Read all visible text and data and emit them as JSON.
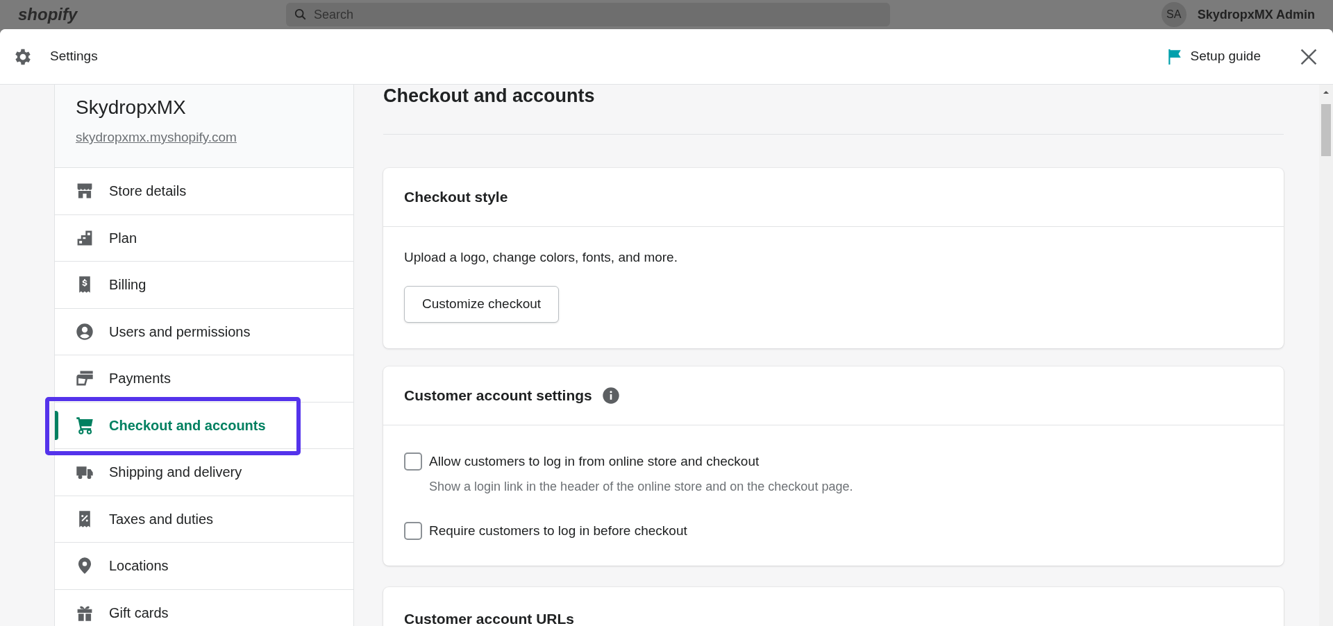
{
  "backdrop": {
    "logo": "shopify",
    "search_placeholder": "Search",
    "avatar": "SA",
    "account": "SkydropxMX Admin"
  },
  "window": {
    "title": "Settings",
    "setup_guide": "Setup guide"
  },
  "sidebar": {
    "store_name": "SkydropxMX",
    "store_url": "skydropxmx.myshopify.com",
    "items": [
      {
        "label": "Store details",
        "kind": "store",
        "selected": false,
        "highlighted": false
      },
      {
        "label": "Plan",
        "kind": "plan",
        "selected": false,
        "highlighted": false
      },
      {
        "label": "Billing",
        "kind": "billing",
        "selected": false,
        "highlighted": false
      },
      {
        "label": "Users and permissions",
        "kind": "user",
        "selected": false,
        "highlighted": false
      },
      {
        "label": "Payments",
        "kind": "payments",
        "selected": false,
        "highlighted": false
      },
      {
        "label": "Checkout and accounts",
        "kind": "cart",
        "selected": true,
        "highlighted": true
      },
      {
        "label": "Shipping and delivery",
        "kind": "truck",
        "selected": false,
        "highlighted": false
      },
      {
        "label": "Taxes and duties",
        "kind": "tax",
        "selected": false,
        "highlighted": false
      },
      {
        "label": "Locations",
        "kind": "pin",
        "selected": false,
        "highlighted": false
      },
      {
        "label": "Gift cards",
        "kind": "gift",
        "selected": false,
        "highlighted": false
      }
    ]
  },
  "page": {
    "title": "Checkout and accounts"
  },
  "checkout_style": {
    "title": "Checkout style",
    "description": "Upload a logo, change colors, fonts, and more.",
    "button": "Customize checkout"
  },
  "customer_account_settings": {
    "title": "Customer account settings",
    "options": [
      {
        "label": "Allow customers to log in from online store and checkout",
        "help": "Show a login link in the header of the online store and on the checkout page.",
        "checked": false
      },
      {
        "label": "Require customers to log in before checkout",
        "checked": false
      }
    ]
  },
  "customer_account_urls": {
    "title": "Customer account URLs"
  }
}
